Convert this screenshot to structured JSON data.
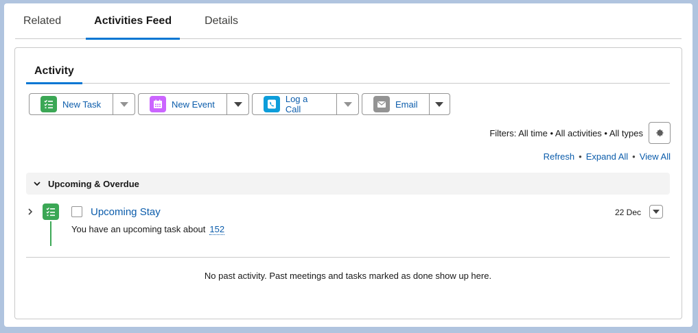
{
  "tabs": [
    "Related",
    "Activities Feed",
    "Details"
  ],
  "activity_tab": "Activity",
  "actions": [
    {
      "label": "New Task",
      "icon": "task-icon",
      "color": "#3ba755"
    },
    {
      "label": "New Event",
      "icon": "calendar-icon",
      "color": "#cb65ff"
    },
    {
      "label": "Log a Call",
      "icon": "phone-icon",
      "color": "#0d9dda"
    },
    {
      "label": "Email",
      "icon": "email-icon",
      "color": "#939393"
    }
  ],
  "filters": "Filters: All time • All activities • All types",
  "links": {
    "refresh": "Refresh",
    "expand_all": "Expand All",
    "view_all": "View All"
  },
  "section": {
    "title": "Upcoming & Overdue"
  },
  "task": {
    "title": "Upcoming Stay",
    "subtitle": "You have an upcoming task about",
    "link": "152",
    "date": "22 Dec"
  },
  "empty_message": "No past activity. Past meetings and tasks marked as done show up here."
}
